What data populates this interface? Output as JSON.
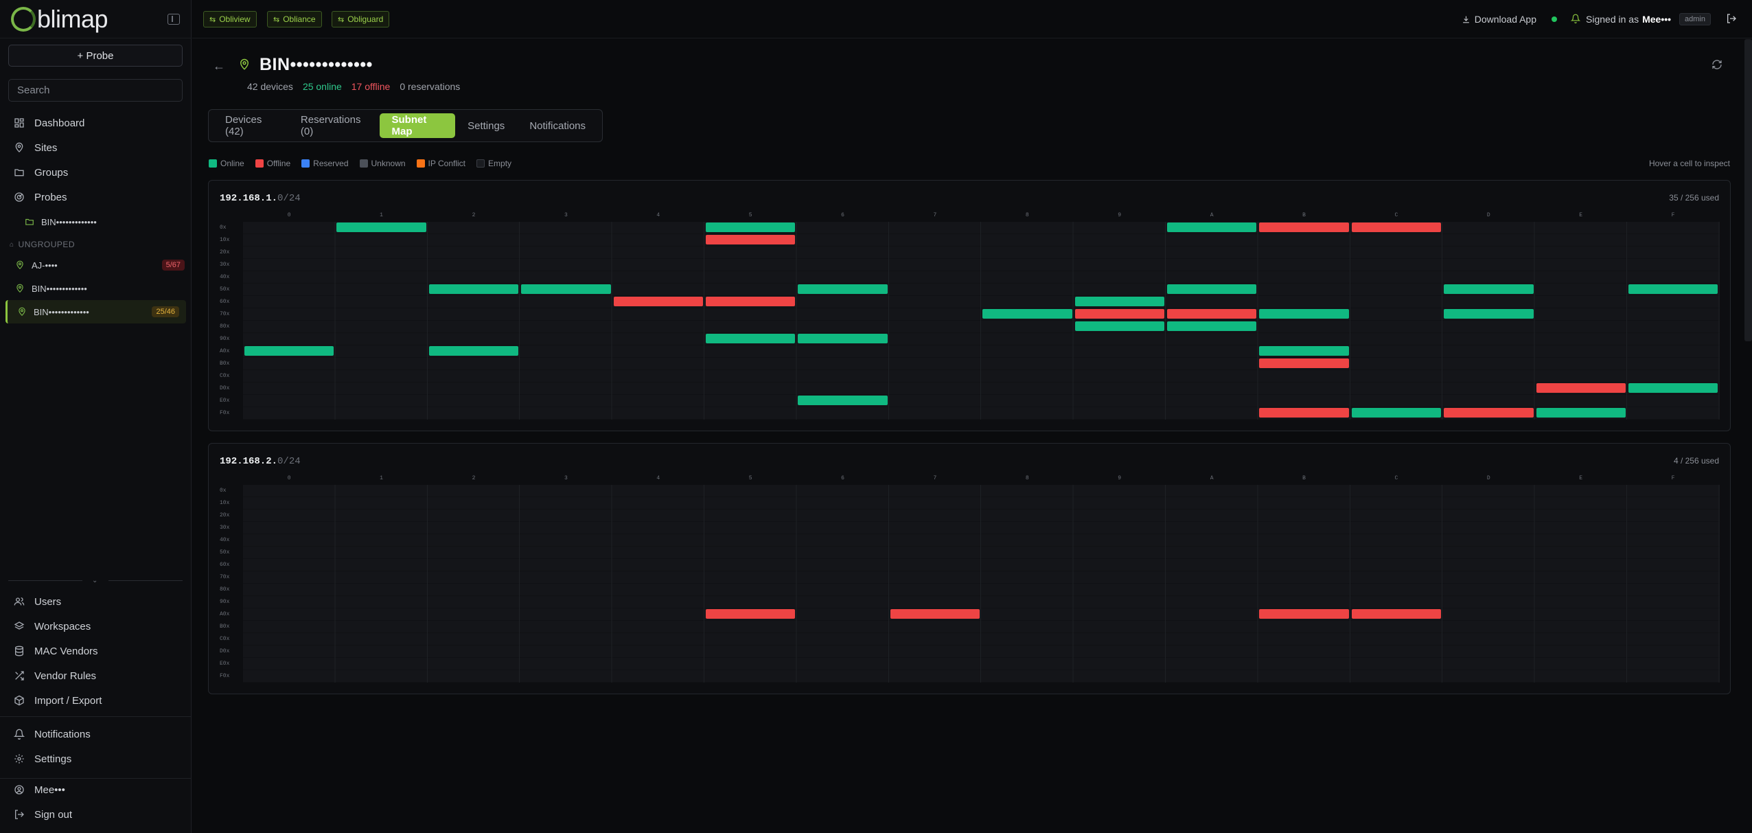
{
  "app": {
    "logo_text": "blimap",
    "probe_button": "+ Probe",
    "search_placeholder": "Search"
  },
  "nav": {
    "main": [
      {
        "label": "Dashboard",
        "icon": "grid-icon"
      },
      {
        "label": "Sites",
        "icon": "pin-icon"
      },
      {
        "label": "Groups",
        "icon": "folder-icon"
      },
      {
        "label": "Probes",
        "icon": "radar-icon"
      }
    ],
    "probe_sub": "BIN•••••••••••••",
    "ungrouped_label": "UNGROUPED",
    "sites": [
      {
        "name": "AJ-••••",
        "badge": "5/67",
        "badge_type": "red"
      },
      {
        "name": "BIN•••••••••••••",
        "badge": "",
        "badge_type": ""
      },
      {
        "name": "BIN•••••••••••••",
        "badge": "25/46",
        "badge_type": "amber",
        "active": true
      }
    ],
    "admin": [
      {
        "label": "Users",
        "icon": "users-icon"
      },
      {
        "label": "Workspaces",
        "icon": "layers-icon"
      },
      {
        "label": "MAC Vendors",
        "icon": "database-icon"
      },
      {
        "label": "Vendor Rules",
        "icon": "shuffle-icon"
      },
      {
        "label": "Import / Export",
        "icon": "package-icon"
      }
    ],
    "bottom": [
      {
        "label": "Notifications",
        "icon": "bell-icon"
      },
      {
        "label": "Settings",
        "icon": "gear-icon"
      }
    ],
    "account": [
      {
        "label": "Mee•••",
        "icon": "user-circle-icon"
      },
      {
        "label": "Sign out",
        "icon": "logout-icon"
      }
    ]
  },
  "topbar": {
    "apps": [
      "Obliview",
      "Obliance",
      "Obliguard"
    ],
    "download": "Download App",
    "signed_in_prefix": "Signed in as",
    "user": "Mee•••",
    "role": "admin"
  },
  "header": {
    "title": "BIN•••••••••••••",
    "devices": "42 devices",
    "online": "25 online",
    "offline": "17 offline",
    "reservations": "0 reservations"
  },
  "tabs": [
    {
      "label": "Devices (42)",
      "active": false
    },
    {
      "label": "Reservations (0)",
      "active": false
    },
    {
      "label": "Subnet Map",
      "active": true
    },
    {
      "label": "Settings",
      "active": false
    },
    {
      "label": "Notifications",
      "active": false
    }
  ],
  "legend": [
    {
      "label": "Online",
      "color": "#10b981"
    },
    {
      "label": "Offline",
      "color": "#ef4444"
    },
    {
      "label": "Reserved",
      "color": "#3b82f6"
    },
    {
      "label": "Unknown",
      "color": "#4b5058"
    },
    {
      "label": "IP Conflict",
      "color": "#f97316"
    },
    {
      "label": "Empty",
      "color": "#1a1c20"
    }
  ],
  "hover_hint": "Hover a cell to inspect",
  "col_headers": [
    "0",
    "1",
    "2",
    "3",
    "4",
    "5",
    "6",
    "7",
    "8",
    "9",
    "A",
    "B",
    "C",
    "D",
    "E",
    "F"
  ],
  "row_headers": [
    "0x",
    "10x",
    "20x",
    "30x",
    "40x",
    "50x",
    "60x",
    "70x",
    "80x",
    "90x",
    "A0x",
    "B0x",
    "C0x",
    "D0x",
    "E0x",
    "F0x"
  ],
  "subnets": [
    {
      "prefix": "192.168.1.",
      "suffix": "0/24",
      "used": "35 / 256 used",
      "cells": [
        {
          "r": 0,
          "c": 1,
          "s": "online"
        },
        {
          "r": 0,
          "c": 5,
          "s": "online"
        },
        {
          "r": 0,
          "c": 10,
          "s": "online"
        },
        {
          "r": 0,
          "c": 11,
          "s": "offline"
        },
        {
          "r": 0,
          "c": 12,
          "s": "offline"
        },
        {
          "r": 1,
          "c": 5,
          "s": "offline"
        },
        {
          "r": 5,
          "c": 2,
          "s": "online"
        },
        {
          "r": 5,
          "c": 3,
          "s": "online"
        },
        {
          "r": 5,
          "c": 6,
          "s": "online"
        },
        {
          "r": 5,
          "c": 10,
          "s": "online"
        },
        {
          "r": 5,
          "c": 13,
          "s": "online"
        },
        {
          "r": 5,
          "c": 15,
          "s": "online"
        },
        {
          "r": 6,
          "c": 4,
          "s": "offline"
        },
        {
          "r": 6,
          "c": 5,
          "s": "offline"
        },
        {
          "r": 6,
          "c": 9,
          "s": "online"
        },
        {
          "r": 7,
          "c": 8,
          "s": "online"
        },
        {
          "r": 7,
          "c": 9,
          "s": "offline"
        },
        {
          "r": 7,
          "c": 10,
          "s": "offline"
        },
        {
          "r": 7,
          "c": 11,
          "s": "online"
        },
        {
          "r": 7,
          "c": 13,
          "s": "online"
        },
        {
          "r": 8,
          "c": 9,
          "s": "online"
        },
        {
          "r": 8,
          "c": 10,
          "s": "online"
        },
        {
          "r": 9,
          "c": 5,
          "s": "online"
        },
        {
          "r": 9,
          "c": 6,
          "s": "online"
        },
        {
          "r": 10,
          "c": 0,
          "s": "online"
        },
        {
          "r": 10,
          "c": 2,
          "s": "online"
        },
        {
          "r": 10,
          "c": 11,
          "s": "online"
        },
        {
          "r": 11,
          "c": 11,
          "s": "offline"
        },
        {
          "r": 13,
          "c": 14,
          "s": "offline"
        },
        {
          "r": 13,
          "c": 15,
          "s": "online"
        },
        {
          "r": 14,
          "c": 6,
          "s": "online"
        },
        {
          "r": 15,
          "c": 11,
          "s": "offline"
        },
        {
          "r": 15,
          "c": 12,
          "s": "online"
        },
        {
          "r": 15,
          "c": 13,
          "s": "offline"
        },
        {
          "r": 15,
          "c": 14,
          "s": "online"
        }
      ]
    },
    {
      "prefix": "192.168.2.",
      "suffix": "0/24",
      "used": "4 / 256 used",
      "cells": [
        {
          "r": 10,
          "c": 5,
          "s": "offline"
        },
        {
          "r": 10,
          "c": 7,
          "s": "offline"
        },
        {
          "r": 10,
          "c": 11,
          "s": "offline"
        },
        {
          "r": 10,
          "c": 12,
          "s": "offline"
        }
      ]
    }
  ]
}
